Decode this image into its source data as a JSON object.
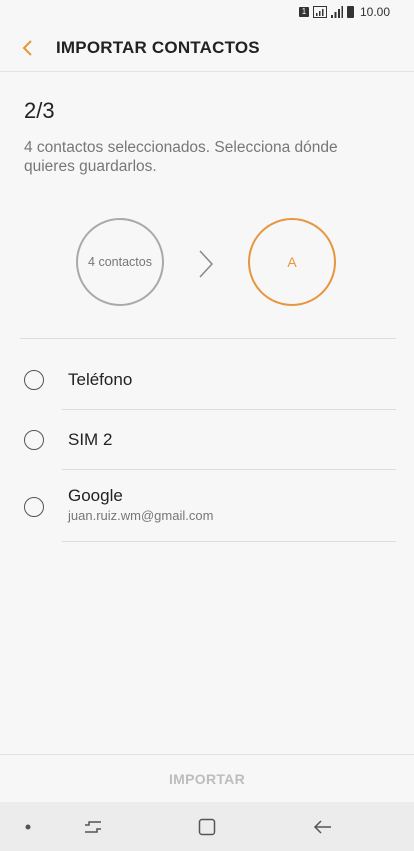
{
  "status_bar": {
    "sim": "1",
    "time": "10.00",
    "icons": [
      "sim-badge-icon",
      "signal-icon",
      "battery-icon"
    ]
  },
  "header": {
    "title": "IMPORTAR CONTACTOS",
    "back_icon": "chevron-left-icon",
    "accent_color": "#e8953d"
  },
  "step": "2/3",
  "description": "4 contactos seleccionados. Selecciona dónde quieres guardarlos.",
  "flow": {
    "source_label": "4 contactos",
    "target_label": "A"
  },
  "options": [
    {
      "label": "Teléfono",
      "sub": ""
    },
    {
      "label": "SIM 2",
      "sub": ""
    },
    {
      "label": "Google",
      "sub": "juan.ruiz.wm@gmail.com"
    }
  ],
  "footer": {
    "import_label": "IMPORTAR"
  },
  "nav": {
    "icons": [
      "dot-icon",
      "recents-icon",
      "home-icon",
      "back-icon"
    ]
  }
}
